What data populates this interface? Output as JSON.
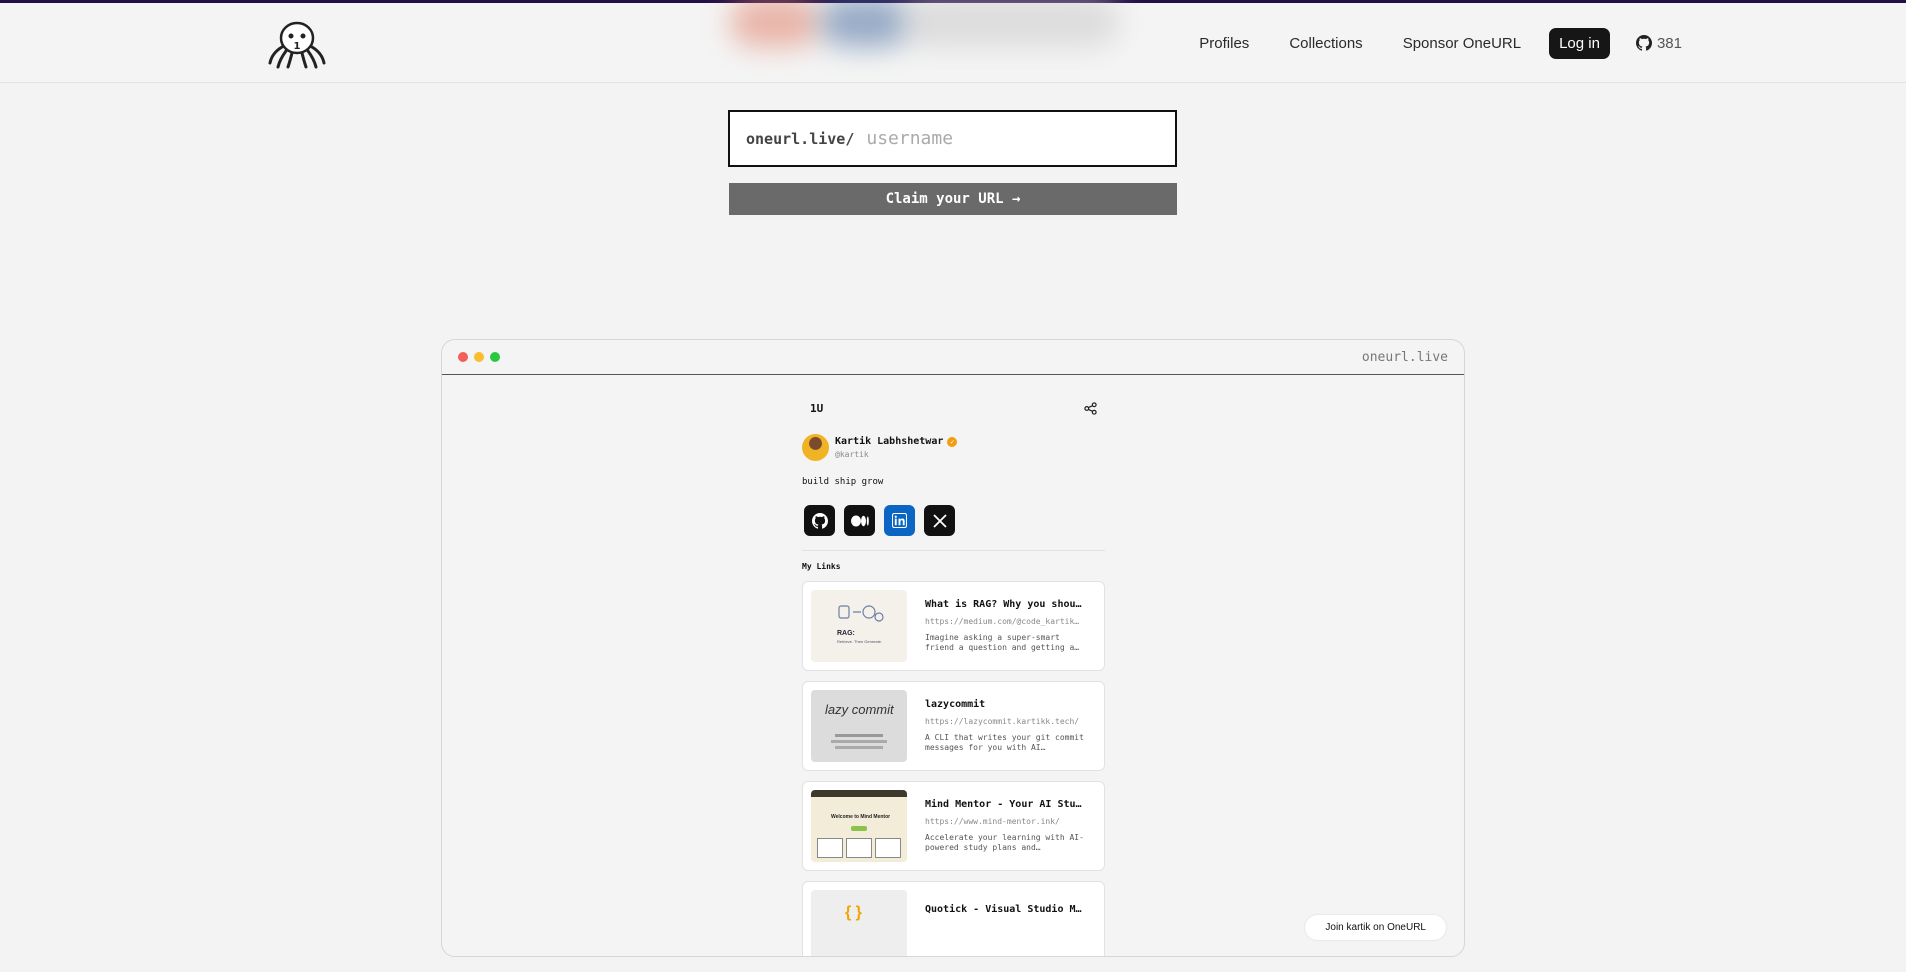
{
  "nav": {
    "links": [
      "Profiles",
      "Collections",
      "Sponsor OneURL"
    ],
    "login": "Log in",
    "github_stars": "381"
  },
  "claim": {
    "prefix": "oneurl.live/",
    "placeholder": "username",
    "button": "Claim your URL →"
  },
  "browser": {
    "url": "oneurl.live"
  },
  "profile": {
    "mini_logo": "1U",
    "name": "Kartik Labhshetwar",
    "handle": "@kartik",
    "bio": "build ship grow",
    "section_title": "My Links",
    "links": [
      {
        "title": "What is RAG? Why you should…",
        "url": "https://medium.com/@code_kartik…",
        "desc": "Imagine asking a super-smart friend a question and getting a…"
      },
      {
        "title": "lazycommit",
        "url": "https://lazycommit.kartikk.tech/",
        "desc": "A CLI that writes your git commit messages for you with AI…"
      },
      {
        "title": "Mind Mentor - Your AI Study…",
        "url": "https://www.mind-mentor.ink/",
        "desc": "Accelerate your learning with AI-powered study plans and…"
      },
      {
        "title": "Quotick - Visual Studio Mar…",
        "url": "",
        "desc": ""
      }
    ],
    "join": "Join kartik on OneURL"
  },
  "thumbs": {
    "rag_label": "RAG:",
    "rag_sub": "Retrieve. Then Generate.",
    "lazy_label": "lazy commit",
    "mind_label": "Welcome to Mind Mentor"
  }
}
